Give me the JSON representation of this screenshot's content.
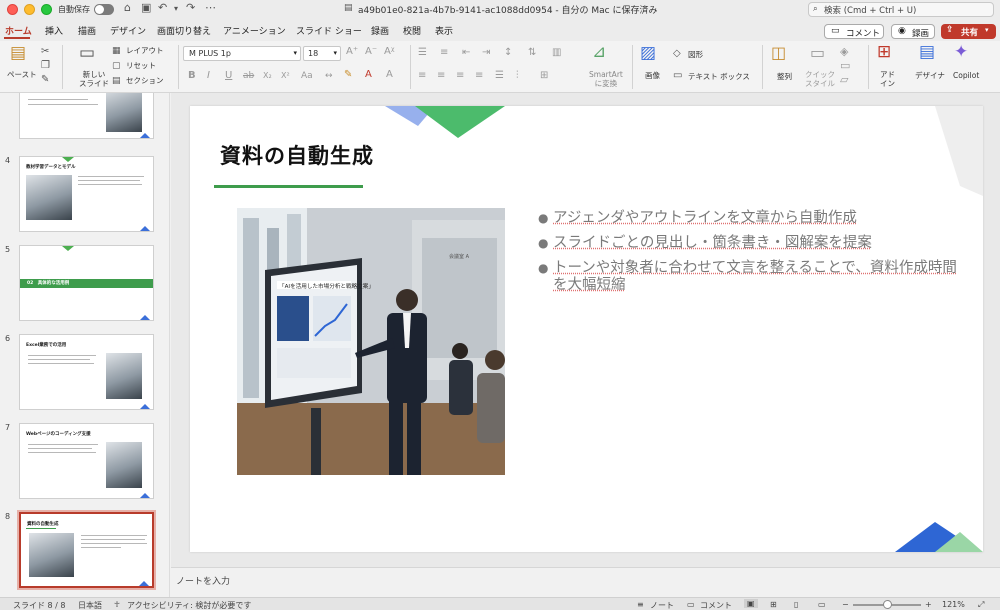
{
  "titlebar": {
    "autosave_label": "自動保存",
    "doc_title": "a49b01e0-821a-4b7b-9141-ac1088dd0954 - 自分の Mac に保存済み",
    "search_placeholder": "検索 (Cmd + Ctrl + U)"
  },
  "tabs": [
    "ホーム",
    "挿入",
    "描画",
    "デザイン",
    "画面切り替え",
    "アニメーション",
    "スライド ショー",
    "録画",
    "校閲",
    "表示"
  ],
  "header_buttons": {
    "comment": "コメント",
    "record": "録画",
    "share": "共有"
  },
  "ribbon": {
    "paste": "ペースト",
    "new_slide": "新しい\nスライド",
    "layout": "レイアウト",
    "reset": "リセット",
    "section": "セクション",
    "font_name": "M PLUS 1p",
    "font_size": "18",
    "smartart": "SmartArt\nに変換",
    "picture": "画像",
    "shapes": "図形",
    "textbox": "テキスト ボックス",
    "arrange": "整列",
    "quick_styles": "クイック\nスタイル",
    "addins": "アド\nイン",
    "designer": "デザイナ",
    "copilot": "Copilot"
  },
  "slides": [
    {
      "num": "4",
      "title": "教材学習データとモデル"
    },
    {
      "num": "5",
      "title": "02　具体的な活用例"
    },
    {
      "num": "6",
      "title": "Excel業務での活用"
    },
    {
      "num": "7",
      "title": "Webページのコーディング支援"
    },
    {
      "num": "8",
      "title": "資料の自動生成"
    }
  ],
  "current_slide": {
    "title": "資料の自動生成",
    "photo_screen_text": "「AIを活用した市場分析と戦略立案」",
    "photo_room_sign": "会議室 A",
    "bullets": [
      "アジェンダやアウトラインを文章から自動作成",
      "スライドごとの見出し・箇条書き・図解案を提案",
      "トーンや対象者に合わせて文言を整えることで、資料作成時間を大幅短縮"
    ]
  },
  "notes_placeholder": "ノートを入力",
  "status": {
    "slide_count": "スライド 8 / 8",
    "language": "日本語",
    "accessibility": "アクセシビリティ: 検討が必要です",
    "notes": "ノート",
    "comments": "コメント",
    "zoom": "121%"
  },
  "colors": {
    "accent": "#b83b2b",
    "green": "#3e9c4c",
    "blue": "#3b6fd9"
  }
}
